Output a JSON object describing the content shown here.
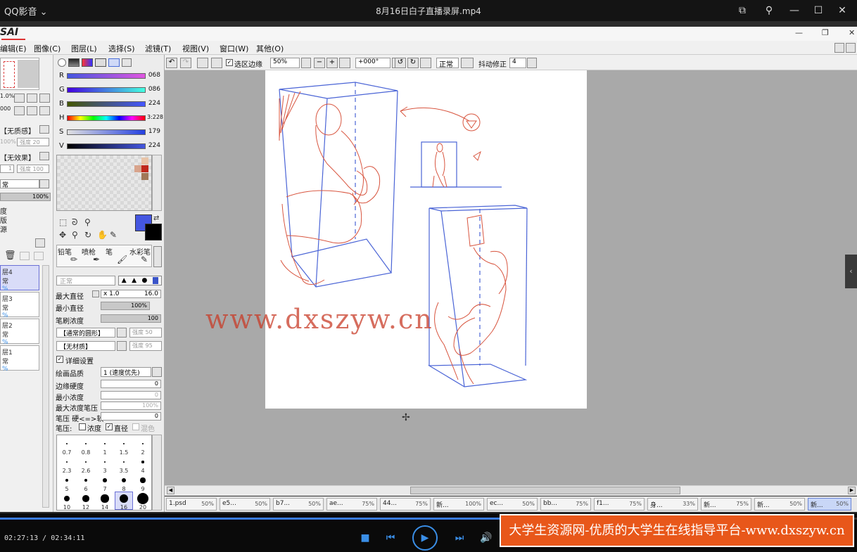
{
  "player": {
    "app_name": "QQ影音",
    "video_title": "8月16日白子直播录屏.mp4",
    "time": "02:27:13 / 02:34:11",
    "progress": 0.975,
    "banner": "大学生资源网-优质的大学生在线指导平台-www.dxszyw.cn"
  },
  "sai": {
    "logo": "SAI",
    "menus": [
      "编辑(E)",
      "图像(C)",
      "图层(L)",
      "选择(S)",
      "滤镜(T)",
      "视图(V)",
      "窗口(W)",
      "其他(O)"
    ],
    "toolbar": {
      "select_edge_label": "选区边缘",
      "zoom": "50%",
      "angle": "+000°",
      "blend": "正常",
      "stabilizer_label": "抖动修正",
      "stabilizer_value": "4"
    },
    "left": {
      "zoom_val": "1.0%",
      "angle_val": "000",
      "texture": "【无质感】",
      "texture_strength_label": "强度",
      "texture_strength": "20",
      "effect": "【无效果】",
      "effect_width": "1",
      "effect_strength_label": "强度",
      "effect_strength": "100",
      "mode": "常",
      "opacity": "100%",
      "props": [
        "度",
        "版",
        "源"
      ],
      "layers": [
        {
          "name": "层4",
          "mode": "常",
          "pct": "%"
        },
        {
          "name": "层3",
          "mode": "常",
          "pct": "%"
        },
        {
          "name": "层2",
          "mode": "常",
          "pct": "%"
        },
        {
          "name": "层1",
          "mode": "常",
          "pct": "%"
        }
      ]
    },
    "color": {
      "rgb": [
        {
          "label": "R",
          "value": "068"
        },
        {
          "label": "G",
          "value": "086"
        },
        {
          "label": "B",
          "value": "224"
        }
      ],
      "hsv": [
        {
          "label": "H",
          "value": "3:228"
        },
        {
          "label": "S",
          "value": "179"
        },
        {
          "label": "V",
          "value": "224"
        }
      ],
      "primary_color": "#4456e0"
    },
    "tools": [
      "铅笔",
      "喷枪",
      "笔",
      "水彩笔"
    ],
    "brush": {
      "mode_label": "正常",
      "max_size_label": "最大直径",
      "max_size_mult": "x 1.0",
      "max_size": "16.0",
      "min_size_label": "最小直径",
      "min_size": "100%",
      "density_label": "笔刷浓度",
      "density": "100",
      "shape": "【通常的圆形】",
      "shape_strength_label": "强度",
      "shape_strength": "50",
      "texture": "【无材质】",
      "texture_strength_label": "强度",
      "texture_strength": "95",
      "detail_label": "详细设置",
      "quality_label": "绘画品质",
      "quality": "1 (速度优先)",
      "edge_label": "边缘硬度",
      "edge": "0",
      "min_density_label": "最小浓度",
      "min_density": "0",
      "max_pressure_label": "最大浓度笔压",
      "max_pressure": "100%",
      "pressure_label": "笔压 硬<=>软",
      "pressure": "0",
      "pressure_opts_label": "笔压:",
      "opt_density": "浓度",
      "opt_size": "直径",
      "opt_blend": "混色"
    },
    "brush_sizes": [
      "0.7",
      "0.8",
      "1",
      "1.5",
      "2",
      "2.3",
      "2.6",
      "3",
      "3.5",
      "4",
      "5",
      "6",
      "7",
      "8",
      "9",
      "10",
      "12",
      "14",
      "16",
      "20"
    ],
    "tabs": [
      {
        "name": "1.psd",
        "pct": "50%"
      },
      {
        "name": "e5...",
        "pct": "50%"
      },
      {
        "name": "b7...",
        "pct": "50%"
      },
      {
        "name": "ae...",
        "pct": "75%"
      },
      {
        "name": "44...",
        "pct": "75%"
      },
      {
        "name": "新...",
        "pct": "100%"
      },
      {
        "name": "ec...",
        "pct": "50%"
      },
      {
        "name": "bb...",
        "pct": "75%"
      },
      {
        "name": "f1...",
        "pct": "75%"
      },
      {
        "name": "身...",
        "pct": "33%"
      },
      {
        "name": "新...",
        "pct": "75%"
      },
      {
        "name": "新...",
        "pct": "50%"
      },
      {
        "name": "新...",
        "pct": "50%"
      }
    ],
    "watermark": "www.dxszyw.cn"
  }
}
